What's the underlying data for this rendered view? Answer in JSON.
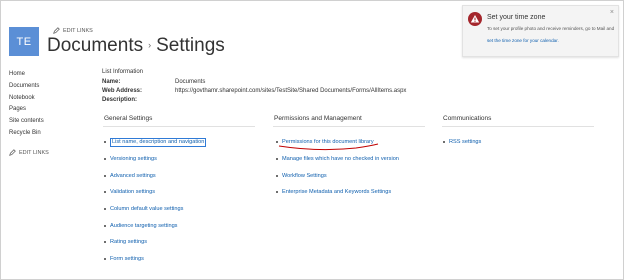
{
  "site": {
    "logo_initials": "TE",
    "edit_links_label": "EDIT LINKS",
    "title": "Documents",
    "separator": "›",
    "subtitle": "Settings"
  },
  "leftnav": {
    "items": [
      {
        "label": "Home"
      },
      {
        "label": "Documents"
      },
      {
        "label": "Notebook"
      },
      {
        "label": "Pages"
      },
      {
        "label": "Site contents"
      },
      {
        "label": "Recycle Bin"
      }
    ],
    "edit_links_label": "EDIT LINKS"
  },
  "list_info": {
    "heading": "List Information",
    "name_label": "Name:",
    "name_value": "Documents",
    "web_address_label": "Web Address:",
    "web_address_value": "https://govthamr.sharepoint.com/sites/TestSite/Shared Documents/Forms/AllItems.aspx",
    "description_label": "Description:",
    "description_value": ""
  },
  "general_settings": {
    "heading": "General Settings",
    "links": [
      {
        "label": "List name, description and navigation"
      },
      {
        "label": "Versioning settings"
      },
      {
        "label": "Advanced settings"
      },
      {
        "label": "Validation settings"
      },
      {
        "label": "Column default value settings"
      },
      {
        "label": "Audience targeting settings"
      },
      {
        "label": "Rating settings"
      },
      {
        "label": "Form settings"
      }
    ]
  },
  "permissions": {
    "heading": "Permissions and Management",
    "links": [
      {
        "label": "Permissions for this document library"
      },
      {
        "label": "Manage files which have no checked in version"
      },
      {
        "label": "Workflow Settings"
      },
      {
        "label": "Enterprise Metadata and Keywords Settings"
      }
    ]
  },
  "communications": {
    "heading": "Communications",
    "links": [
      {
        "label": "RSS settings"
      }
    ]
  },
  "notification": {
    "title": "Set your time zone",
    "body": "To set your profile photo and receive reminders, go to Mail and",
    "link": "set the time zone for your calendar.",
    "close": "×"
  },
  "icons": {
    "edit": "pencil-icon",
    "alert": "alert-icon",
    "close": "close-icon"
  },
  "colors": {
    "logo_bg": "#5b8fd6",
    "link": "#0f5fae",
    "alert": "#a4262c",
    "annotation_underline": "#c00000"
  }
}
